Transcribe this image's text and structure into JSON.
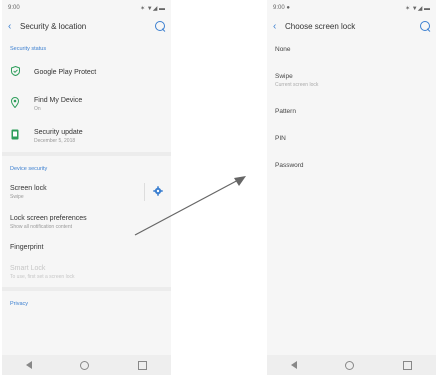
{
  "left_screen": {
    "status_time": "9:00",
    "status_icons": "✶ ▼◢ ▬",
    "title": "Security & location",
    "sections": {
      "security_status": "Security status",
      "device_security": "Device security",
      "privacy": "Privacy"
    },
    "items": {
      "play_protect": {
        "title": "Google Play Protect"
      },
      "find_device": {
        "title": "Find My Device",
        "subtitle": "On"
      },
      "security_update": {
        "title": "Security update",
        "subtitle": "December 5, 2018"
      },
      "screen_lock": {
        "title": "Screen lock",
        "subtitle": "Swipe"
      },
      "lock_prefs": {
        "title": "Lock screen preferences",
        "subtitle": "Show all notification content"
      },
      "fingerprint": {
        "title": "Fingerprint"
      },
      "smart_lock": {
        "title": "Smart Lock",
        "subtitle": "To use, first set a screen lock"
      }
    }
  },
  "right_screen": {
    "status_time": "9:00 ●",
    "status_icons": "✶ ▼◢ ▬",
    "title": "Choose screen lock",
    "options": [
      {
        "title": "None"
      },
      {
        "title": "Swipe",
        "subtitle": "Current screen lock"
      },
      {
        "title": "Pattern"
      },
      {
        "title": "PIN"
      },
      {
        "title": "Password"
      }
    ]
  },
  "colors": {
    "accent": "#3b7fd0",
    "icon_green": "#2e9e5b"
  },
  "icons": [
    "back-arrow-icon",
    "search-icon",
    "shield-check-icon",
    "location-pin-icon",
    "phone-update-icon",
    "gear-icon",
    "nav-back-icon",
    "nav-home-icon",
    "nav-recent-icon"
  ]
}
